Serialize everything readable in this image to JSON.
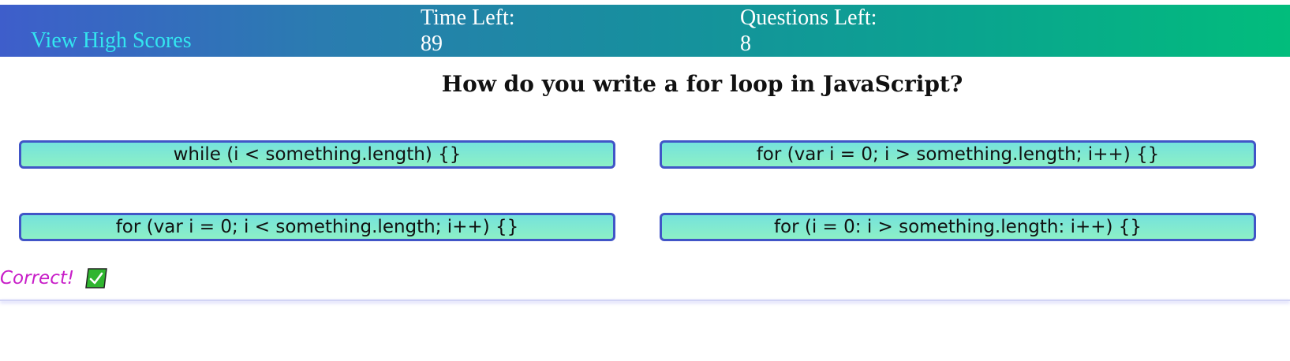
{
  "header": {
    "high_scores_label": "View High Scores",
    "time_label": "Time Left:",
    "time_value": "89",
    "questions_label": "Questions Left:",
    "questions_value": "8"
  },
  "question": {
    "text": "How do you write a for loop in JavaScript?"
  },
  "answers": [
    {
      "label": "while (i < something.length) {}"
    },
    {
      "label": "for (var i = 0; i > something.length; i++) {}"
    },
    {
      "label": "for (var i = 0; i < something.length; i++) {}"
    },
    {
      "label": "for (i = 0: i > something.length: i++) {}"
    }
  ],
  "feedback": {
    "text": "Correct!",
    "icon": "checkmark-icon"
  },
  "colors": {
    "header_gradient_start": "#3e5ecb",
    "header_gradient_end": "#02bd7c",
    "link": "#33e6f0",
    "answer_border": "#4155c7",
    "answer_fill": "#7ee9d3",
    "feedback_text": "#c81ec8",
    "check_box": "#2fb52f"
  }
}
